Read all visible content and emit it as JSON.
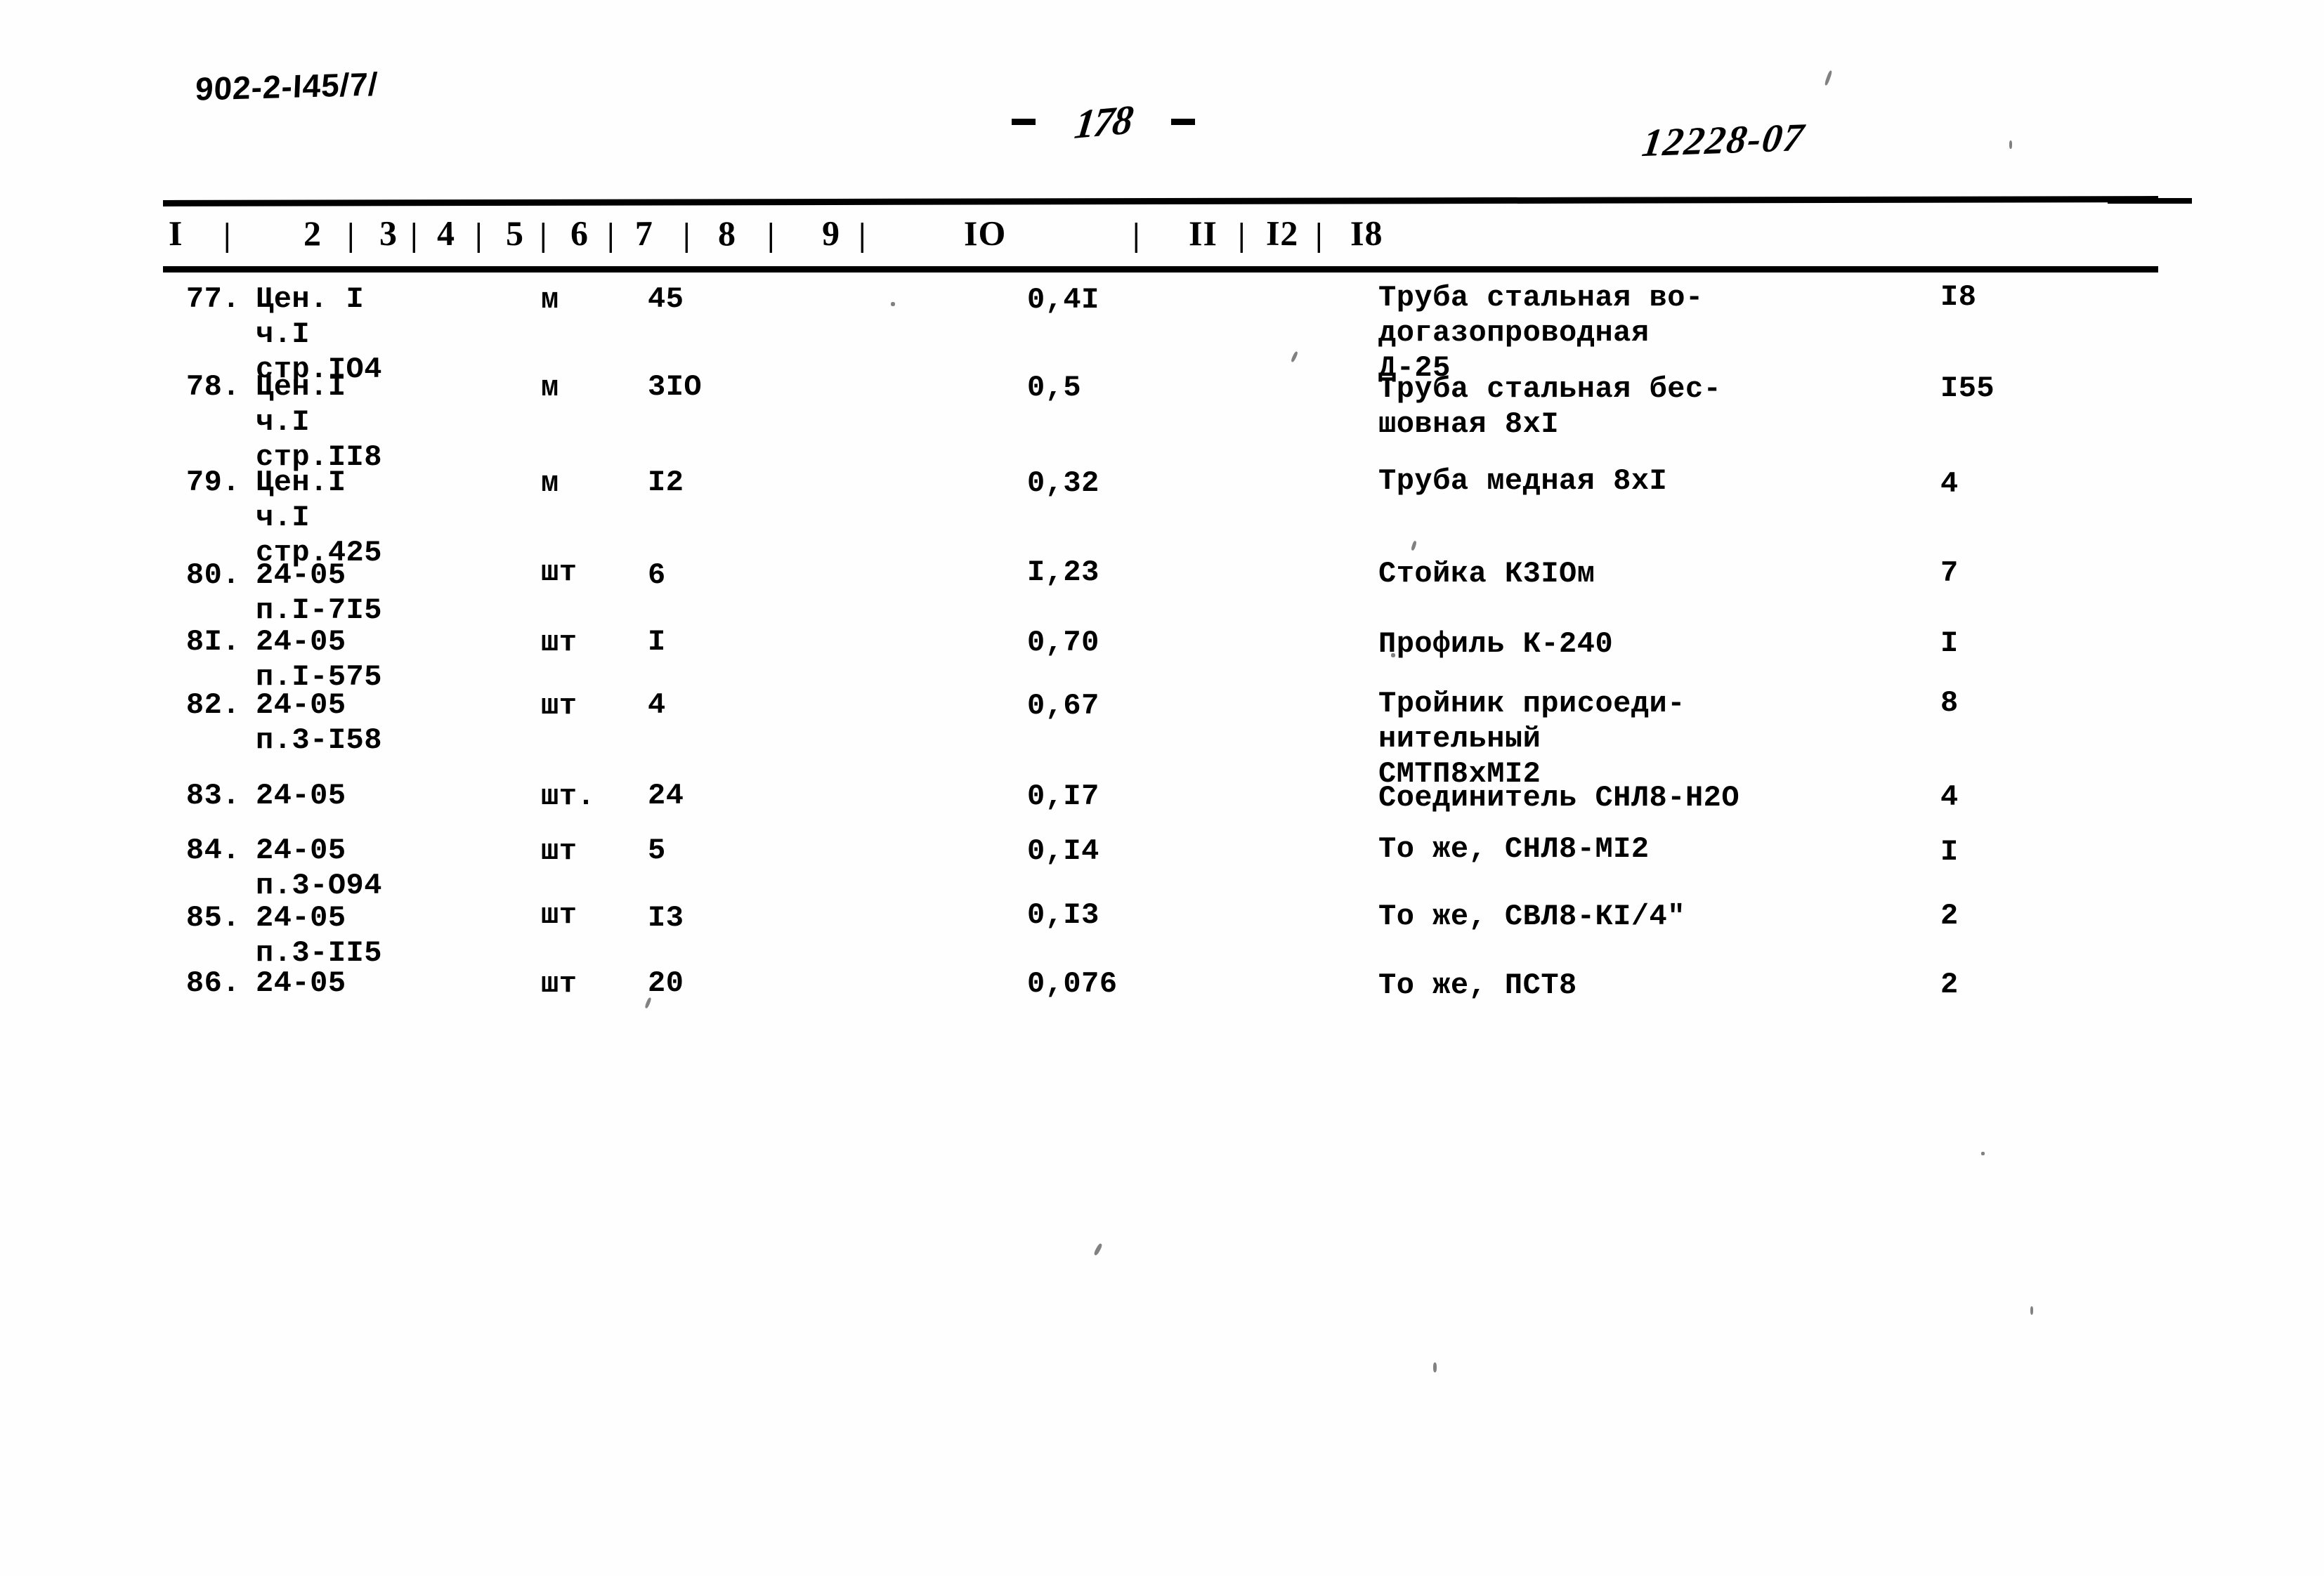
{
  "document": {
    "code": "902-2-I45/7/",
    "page_marker_left": "-",
    "page_number": "178",
    "page_marker_right": "-",
    "archive_number": "12228-07"
  },
  "table": {
    "column_headers": [
      "I",
      "2",
      "3",
      "4",
      "5",
      "6",
      "7",
      "8",
      "9",
      "IO",
      "II",
      "I2",
      "I8"
    ],
    "separator": "|",
    "rows": [
      {
        "num": "77.",
        "justification": "Цен. I\nч.I\nстр.IO4",
        "unit": "м",
        "qty": "45",
        "mass": "0,4I",
        "description": "Труба стальная во-\nдогазопроводная\nД-25",
        "total": "I8"
      },
      {
        "num": "78.",
        "justification": "Цен.I\nч.I\nстр.II8",
        "unit": "м",
        "qty": "3IO",
        "mass": "0,5",
        "description": "Труба стальная бес-\nшовная 8xI",
        "total": "I55"
      },
      {
        "num": "79.",
        "justification": "Цен.I\nч.I\nстр.425",
        "unit": "м",
        "qty": "I2",
        "mass": "0,32",
        "description": "Труба медная 8xI",
        "total": "4"
      },
      {
        "num": "80.",
        "justification": "24-05\nп.I-7I5",
        "unit": "шт",
        "qty": "6",
        "mass": "I,23",
        "description": "Стойка К3IOм",
        "total": "7"
      },
      {
        "num": "8I.",
        "justification": "24-05\nп.I-575",
        "unit": "шт",
        "qty": "I",
        "mass": "0,70",
        "description": "Профиль К-240",
        "total": "I"
      },
      {
        "num": "82.",
        "justification": "24-05\nп.3-I58",
        "unit": "шт",
        "qty": "4",
        "mass": "0,67",
        "description": "Тройник присоеди-\nнительный\nСМТП8хМI2",
        "total": "8"
      },
      {
        "num": "83.",
        "justification": "24-05",
        "unit": "шт.",
        "qty": "24",
        "mass": "0,I7",
        "description": "Соединитель СНЛ8-Н2O",
        "total": "4"
      },
      {
        "num": "84.",
        "justification": "24-05\nп.3-O94",
        "unit": "шт",
        "qty": "5",
        "mass": "0,I4",
        "description": "То же, СНЛ8-МI2",
        "total": "I"
      },
      {
        "num": "85.",
        "justification": "24-05\nп.3-II5",
        "unit": "шт",
        "qty": "I3",
        "mass": "0,I3",
        "description": "То же, СВЛ8-КI/4\"",
        "total": "2"
      },
      {
        "num": "86.",
        "justification": "24-05",
        "unit": "шт",
        "qty": "20",
        "mass": "0,076",
        "description": "То же, ПСТ8",
        "total": "2"
      }
    ]
  }
}
